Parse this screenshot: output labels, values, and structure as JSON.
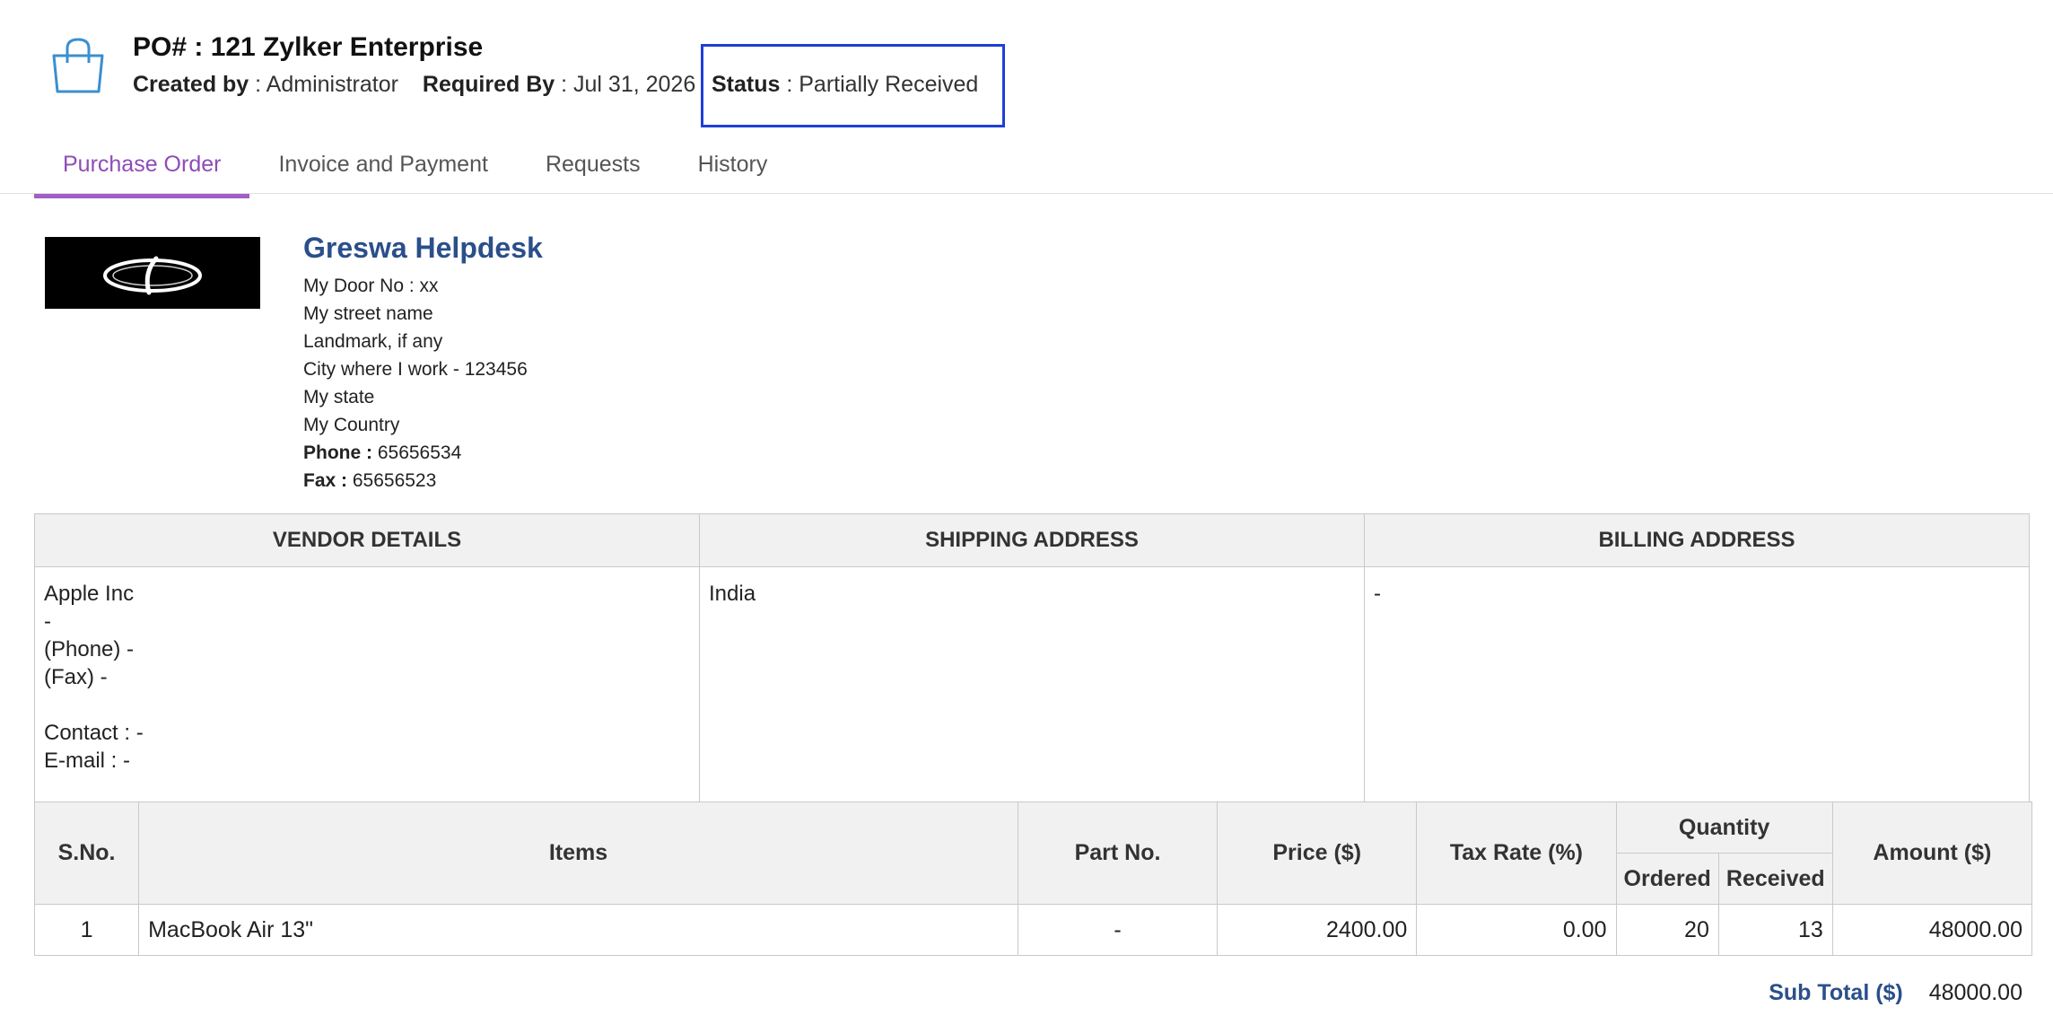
{
  "header": {
    "icon": "shopping-bag-icon",
    "title": "PO# : 121 Zylker Enterprise",
    "created_by_label": "Created by",
    "created_by_value": " : Administrator",
    "required_by_label": "Required By",
    "required_by_value": " : Jul 31, 2026",
    "status_label": "Status",
    "status_value": " : Partially Received"
  },
  "tabs": [
    {
      "label": "Purchase Order",
      "active": true
    },
    {
      "label": "Invoice and Payment",
      "active": false
    },
    {
      "label": "Requests",
      "active": false
    },
    {
      "label": "History",
      "active": false
    }
  ],
  "company": {
    "name": "Greswa Helpdesk",
    "address": [
      "My Door No : xx",
      "My street name",
      "Landmark, if any",
      "City where I work - 123456",
      "My state",
      "My Country"
    ],
    "phone_label": "Phone :",
    "phone_value": " 65656534",
    "fax_label": "Fax :",
    "fax_value": " 65656523"
  },
  "addresses": {
    "headers": [
      "VENDOR DETAILS",
      "SHIPPING ADDRESS",
      "BILLING ADDRESS"
    ],
    "vendor": [
      "Apple Inc",
      "-",
      "(Phone) -",
      "(Fax) -",
      "",
      "Contact : -",
      "E-mail : -"
    ],
    "shipping": "India",
    "billing": "-"
  },
  "items": {
    "headers": {
      "sno": "S.No.",
      "items": "Items",
      "part": "Part No.",
      "price": "Price ($)",
      "tax": "Tax Rate  (%)",
      "quantity": "Quantity",
      "ordered": "Ordered",
      "received": "Received",
      "amount": "Amount  ($)"
    },
    "rows": [
      {
        "sno": "1",
        "item": "MacBook Air 13\"",
        "part": "-",
        "price": "2400.00",
        "tax": "0.00",
        "ordered": "20",
        "received": "13",
        "amount": "48000.00"
      }
    ]
  },
  "totals": {
    "subtotal_label": "Sub Total ($)",
    "subtotal_value": "48000.00"
  },
  "colors": {
    "accent_tab": "#8e4cb6",
    "company_name": "#2a4f8a",
    "status_highlight": "#1f3fd6"
  }
}
